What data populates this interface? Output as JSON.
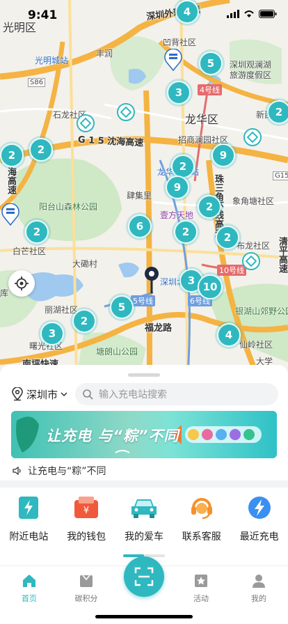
{
  "status_bar": {
    "time": "9:41"
  },
  "map": {
    "clusters": [
      "4",
      "5",
      "3",
      "2",
      "2",
      "2",
      "9",
      "2",
      "9",
      "2",
      "6",
      "2",
      "2",
      "2",
      "3",
      "10",
      "5",
      "2",
      "3",
      "4"
    ],
    "labels": {
      "guangming": "光明区",
      "guangming_station": "光明城站",
      "fengrun": "丰润",
      "s86": "S86",
      "shiyan": "石龙社区",
      "waihuan": "深圳外环高速",
      "aotou": "凹背社区",
      "guanlanhu": "深圳观澜湖",
      "guanlanhu2": "旅游度假区",
      "line4": "4号线",
      "longhua": "龙华区",
      "xinjian": "新西",
      "zhaoshang": "招商澜园社区",
      "yanhai": "G 1 5 沈海高速",
      "longhua_station": "龙华客运站",
      "haiwan": "海高速",
      "forest_park": "阳台山森林公园",
      "sijiji": "肆集里",
      "yifang": "壹方天地",
      "ring": "珠三角环线高速",
      "xiangjiao": "象角塘社区",
      "g15": "G15",
      "baimang": "白芒社区",
      "dalang": "大磡村",
      "budi": "布龙社区",
      "line10": "10号线",
      "shenzhen_north": "深圳北站",
      "line6": "6号线",
      "lihu": "丽湖社区",
      "line5": "5号线",
      "yinhu": "银湖山郊野公园",
      "fulong": "福龙路",
      "xianling": "仙岭社区",
      "shuguang": "曙光社区",
      "nanping": "南坪快速",
      "tanglang": "塘朗山公园",
      "daxue": "大学",
      "qingping": "清平高速",
      "ku": "库"
    }
  },
  "sheet": {
    "city": "深圳市",
    "search_placeholder": "输入充电站搜索",
    "banner_text": "让充电 与“粽”不同",
    "notice_text": "让充电与“粽”不同",
    "shortcuts": [
      {
        "label": "附近电站",
        "icon": "charging-station-icon"
      },
      {
        "label": "我的钱包",
        "icon": "wallet-icon"
      },
      {
        "label": "我的爱车",
        "icon": "car-icon"
      },
      {
        "label": "联系客服",
        "icon": "customer-service-icon"
      },
      {
        "label": "最近充电",
        "icon": "recent-charge-icon"
      }
    ]
  },
  "tabbar": {
    "tabs": [
      {
        "label": "首页",
        "icon": "home-icon",
        "active": true
      },
      {
        "label": "碳积分",
        "icon": "carbon-points-icon",
        "active": false
      },
      {
        "label": "活动",
        "icon": "activity-icon",
        "active": false
      },
      {
        "label": "我的",
        "icon": "profile-icon",
        "active": false
      }
    ],
    "scan_icon": "scan-icon"
  },
  "colors": {
    "accent": "#2fb8bf",
    "metro_red": "#e66b6b",
    "metro_blue": "#6f9ee0"
  }
}
